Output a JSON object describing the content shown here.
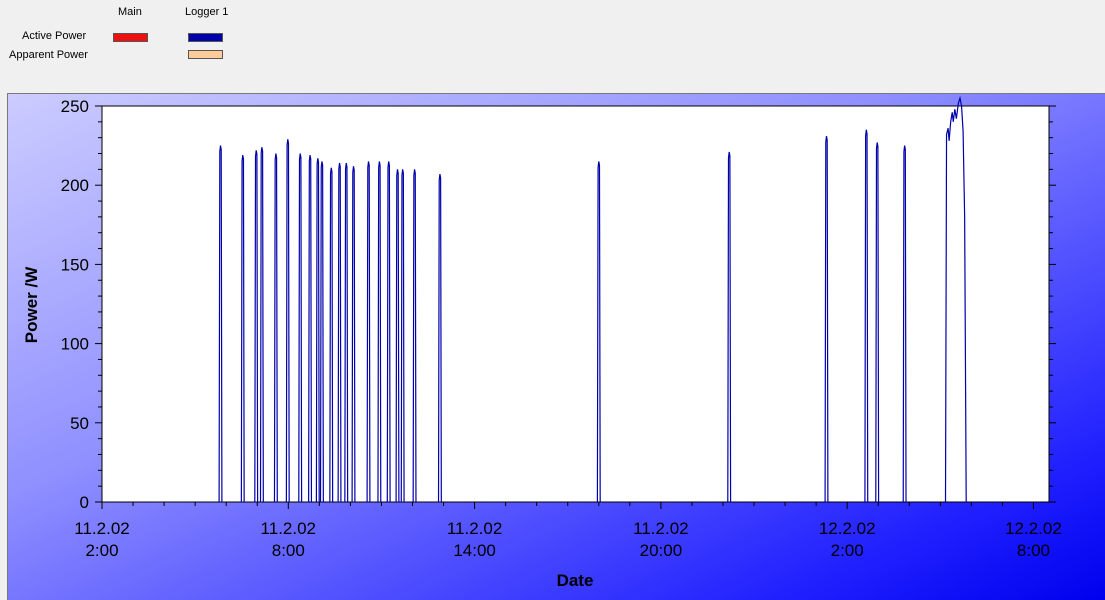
{
  "legend": {
    "col_main": "Main",
    "col_logger": "Logger 1",
    "row_active": "Active Power",
    "row_apparent": "Apparent Power",
    "active_main_color": "#ee1111",
    "active_logger_color": "#0000aa",
    "apparent_logger_color": "#ffcc99"
  },
  "chart_data": {
    "type": "line",
    "title": "",
    "xlabel": "Date",
    "ylabel": "Power /W",
    "ylim": [
      0,
      250
    ],
    "yticks": [
      "0",
      "50",
      "100",
      "150",
      "200",
      "250"
    ],
    "xlim": [
      "2002-02-11 02:00",
      "2002-02-12 08:30"
    ],
    "xticks": [
      {
        "date": "11.2.02",
        "time": "2:00"
      },
      {
        "date": "11.2.02",
        "time": "8:00"
      },
      {
        "date": "11.2.02",
        "time": "14:00"
      },
      {
        "date": "11.2.02",
        "time": "20:00"
      },
      {
        "date": "12.2.02",
        "time": "2:00"
      },
      {
        "date": "12.2.02",
        "time": "8:00"
      }
    ],
    "grid": false,
    "series": [
      {
        "name": "Active Power",
        "color": "#0000aa",
        "spikes": [
          {
            "t": "2002-02-11 05:49",
            "peak": 225
          },
          {
            "t": "2002-02-11 06:32",
            "peak": 219
          },
          {
            "t": "2002-02-11 06:58",
            "peak": 222
          },
          {
            "t": "2002-02-11 07:09",
            "peak": 224
          },
          {
            "t": "2002-02-11 07:36",
            "peak": 220
          },
          {
            "t": "2002-02-11 07:59",
            "peak": 229
          },
          {
            "t": "2002-02-11 08:23",
            "peak": 220
          },
          {
            "t": "2002-02-11 08:42",
            "peak": 219
          },
          {
            "t": "2002-02-11 08:57",
            "peak": 217
          },
          {
            "t": "2002-02-11 09:05",
            "peak": 215
          },
          {
            "t": "2002-02-11 09:23",
            "peak": 211
          },
          {
            "t": "2002-02-11 09:39",
            "peak": 214
          },
          {
            "t": "2002-02-11 09:52",
            "peak": 214
          },
          {
            "t": "2002-02-11 10:06",
            "peak": 212
          },
          {
            "t": "2002-02-11 10:35",
            "peak": 215
          },
          {
            "t": "2002-02-11 10:56",
            "peak": 215
          },
          {
            "t": "2002-02-11 11:14",
            "peak": 215
          },
          {
            "t": "2002-02-11 11:31",
            "peak": 210
          },
          {
            "t": "2002-02-11 11:41",
            "peak": 210
          },
          {
            "t": "2002-02-11 12:04",
            "peak": 210
          },
          {
            "t": "2002-02-11 12:53",
            "peak": 207
          },
          {
            "t": "2002-02-11 18:00",
            "peak": 215
          },
          {
            "t": "2002-02-11 22:12",
            "peak": 221
          },
          {
            "t": "2002-02-12 01:20",
            "peak": 231
          },
          {
            "t": "2002-02-12 02:37",
            "peak": 235
          },
          {
            "t": "2002-02-12 02:58",
            "peak": 227
          },
          {
            "t": "2002-02-12 03:51",
            "peak": 225
          }
        ],
        "segment": [
          {
            "t": "2002-02-12 05:10",
            "v": 0
          },
          {
            "t": "2002-02-12 05:12",
            "v": 232
          },
          {
            "t": "2002-02-12 05:15",
            "v": 236
          },
          {
            "t": "2002-02-12 05:17",
            "v": 228
          },
          {
            "t": "2002-02-12 05:20",
            "v": 240
          },
          {
            "t": "2002-02-12 05:23",
            "v": 246
          },
          {
            "t": "2002-02-12 05:25",
            "v": 240
          },
          {
            "t": "2002-02-12 05:28",
            "v": 248
          },
          {
            "t": "2002-02-12 05:31",
            "v": 242
          },
          {
            "t": "2002-02-12 05:35",
            "v": 252
          },
          {
            "t": "2002-02-12 05:38",
            "v": 255
          },
          {
            "t": "2002-02-12 05:41",
            "v": 250
          },
          {
            "t": "2002-02-12 05:44",
            "v": 234
          },
          {
            "t": "2002-02-12 05:47",
            "v": 180
          },
          {
            "t": "2002-02-12 05:50",
            "v": 0
          }
        ]
      }
    ]
  }
}
